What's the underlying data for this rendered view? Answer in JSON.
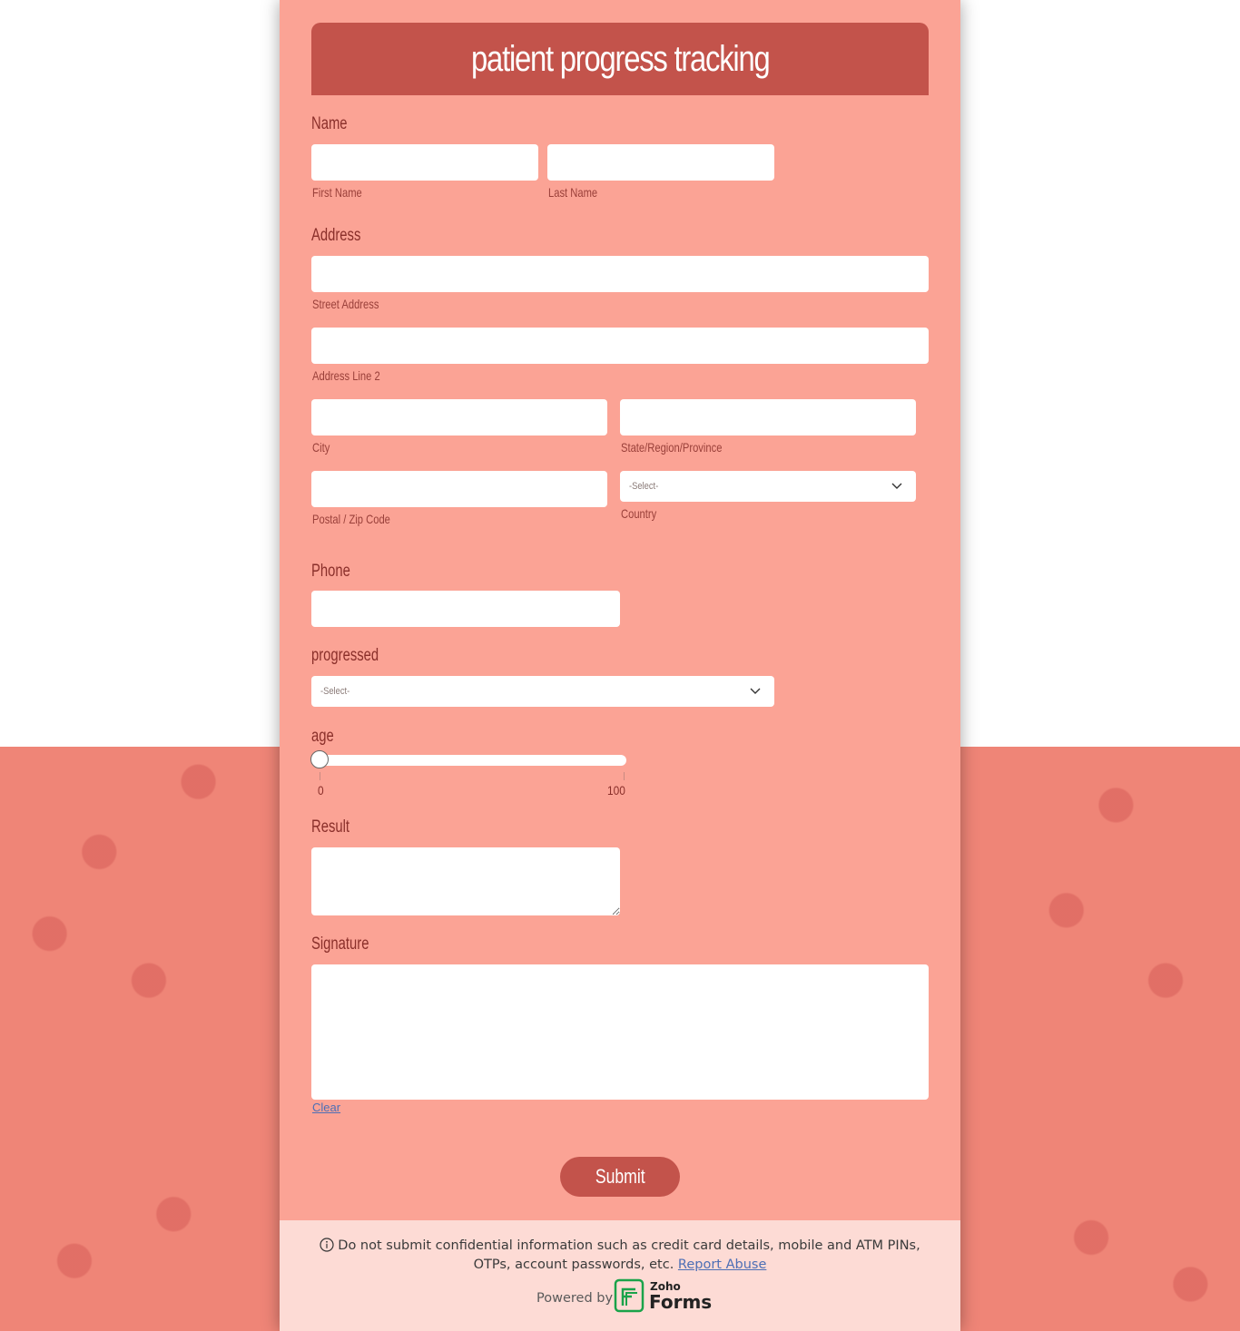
{
  "form": {
    "title": "patient progress tracking",
    "name": {
      "label": "Name",
      "first_sub": "First Name",
      "last_sub": "Last Name",
      "first_value": "",
      "last_value": ""
    },
    "address": {
      "label": "Address",
      "street_sub": "Street Address",
      "line2_sub": "Address Line 2",
      "city_sub": "City",
      "state_sub": "State/Region/Province",
      "zip_sub": "Postal / Zip Code",
      "country_sub": "Country",
      "country_value": "-Select-"
    },
    "phone": {
      "label": "Phone",
      "value": ""
    },
    "progressed": {
      "label": "progressed",
      "value": "-Select-"
    },
    "age": {
      "label": "age",
      "min": "0",
      "max": "100",
      "value": 0
    },
    "result": {
      "label": "Result",
      "value": ""
    },
    "signature": {
      "label": "Signature",
      "clear": "Clear"
    },
    "submit": "Submit"
  },
  "footer": {
    "notice": "Do not submit confidential information such as credit card details, mobile and ATM PINs, OTPs, account passwords, etc.",
    "report": "Report Abuse",
    "powered_by": "Powered by",
    "brand_top": "Zoho",
    "brand_bottom": "Forms"
  },
  "colors": {
    "card": "#fba395",
    "header": "#c3534b",
    "label": "#8a2f2a",
    "background": "#ef8577",
    "footer": "#fddbd5"
  }
}
